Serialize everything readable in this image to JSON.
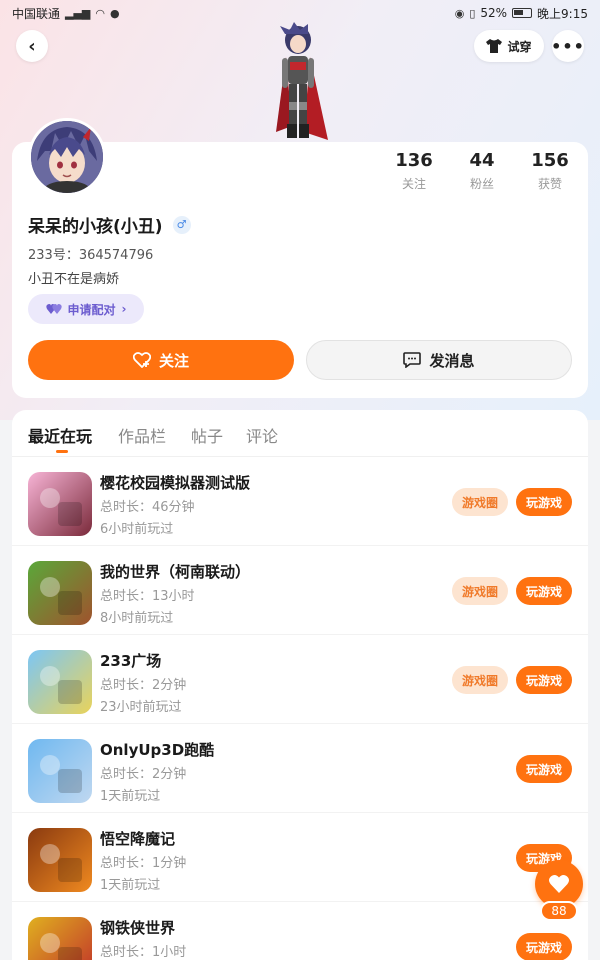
{
  "status_bar": {
    "carrier": "中国联通",
    "battery": "52%",
    "time": "晚上9:15"
  },
  "header": {
    "tryon_label": "试穿"
  },
  "profile": {
    "username": "呆呆的小孩(小丑)",
    "gender_symbol": "♂",
    "uid": "233号：364574796",
    "bio": "小丑不在是病娇",
    "pair_label": "申请配对",
    "stats": [
      {
        "value": "136",
        "label": "关注"
      },
      {
        "value": "44",
        "label": "粉丝"
      },
      {
        "value": "156",
        "label": "获赞"
      }
    ],
    "follow_label": "关注",
    "message_label": "发消息"
  },
  "tabs": [
    "最近在玩",
    "作品栏",
    "帖子",
    "评论"
  ],
  "games": [
    {
      "name": "樱花校园模拟器测试版",
      "duration": "总时长：46分钟",
      "last_played": "6小时前玩过",
      "has_circle": true,
      "icon_colors": [
        "#f7b4d6",
        "#7a2a3a"
      ]
    },
    {
      "name": "我的世界（柯南联动）",
      "duration": "总时长：13小时",
      "last_played": "8小时前玩过",
      "has_circle": true,
      "icon_colors": [
        "#5aa83a",
        "#a0522d"
      ]
    },
    {
      "name": "233广场",
      "duration": "总时长：2分钟",
      "last_played": "23小时前玩过",
      "has_circle": true,
      "icon_colors": [
        "#7cc6f5",
        "#e9d35a"
      ]
    },
    {
      "name": "OnlyUp3D跑酷",
      "duration": "总时长：2分钟",
      "last_played": "1天前玩过",
      "has_circle": false,
      "icon_colors": [
        "#6fb8f0",
        "#c0d8f0"
      ]
    },
    {
      "name": "悟空降魔记",
      "duration": "总时长：1分钟",
      "last_played": "1天前玩过",
      "has_circle": false,
      "icon_colors": [
        "#8a3a10",
        "#f08a20"
      ]
    },
    {
      "name": "钢铁侠世界",
      "duration": "总时长：1小时",
      "last_played": "",
      "has_circle": false,
      "icon_colors": [
        "#e0b020",
        "#c0302a"
      ]
    }
  ],
  "buttons": {
    "circle_label": "游戏圈",
    "play_label": "玩游戏"
  },
  "like_count": "88",
  "colors": {
    "accent": "#ff7210",
    "circle_bg": "#fde4d0",
    "pair_bg": "#ece9fb"
  }
}
